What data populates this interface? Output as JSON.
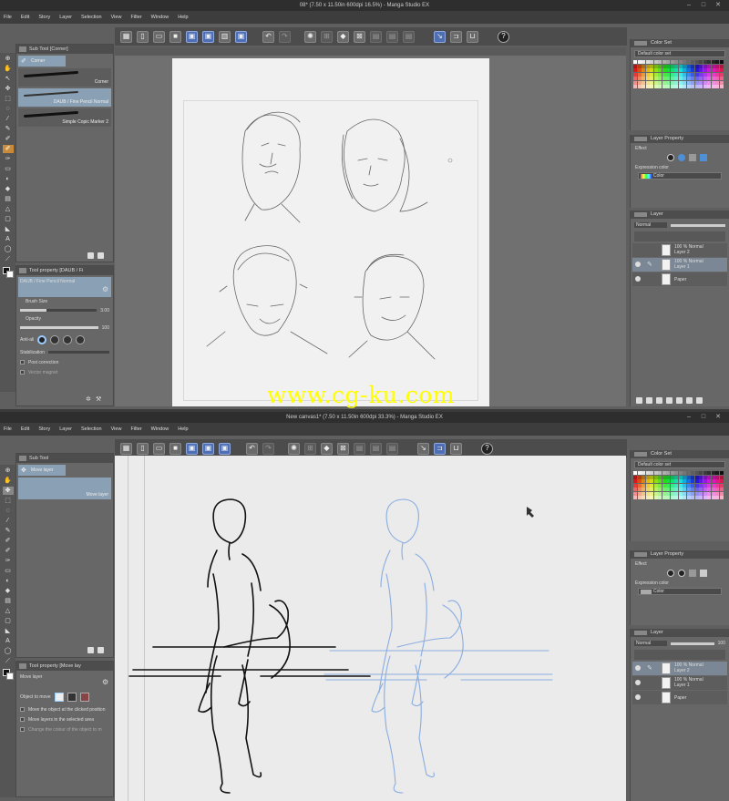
{
  "top_window": {
    "title": "08* (7.50 x 11.50in 600dpi 16.5%) - Manga Studio EX",
    "menu": [
      "File",
      "Edit",
      "Story",
      "Layer",
      "Selection",
      "View",
      "Filter",
      "Window",
      "Help"
    ],
    "sub_tool_tab": "Sub Tool [Corner]",
    "active_group": "Corner",
    "brushes": [
      "Corner",
      "DAUB / Fine Pencil Normal",
      "Simple Copic Marker 2"
    ],
    "tool_property_tab": "Tool property [DAUB / Fi",
    "tool_property_selected": "DAUB / Fine Pencil Normal",
    "brush_size_label": "Brush Size",
    "brush_size_value": "3.00",
    "opacity_label": "Opacity",
    "opacity_value": "100",
    "opacity_fraction": 1.0,
    "brush_size_fraction": 0.35,
    "anti_alias_label": "Anti-ali",
    "stabilization_label": "Stabilization",
    "post_correction_label": "Post correction",
    "vector_magnet_label": "Vector magnet",
    "color_set_tab": "Color Set",
    "color_set_name": "Default color set",
    "layer_property_tab": "Layer Property",
    "effect_label": "Effect",
    "expression_color_label": "Expression color",
    "expression_color_value": "Color",
    "layer_tab": "Layer",
    "blend_mode": "Normal",
    "layers": [
      {
        "pct": "100 %  Normal",
        "name": "Layer 2"
      },
      {
        "pct": "100 %  Normal",
        "name": "Layer 1"
      },
      {
        "pct": "",
        "name": "Paper"
      }
    ]
  },
  "bottom_window": {
    "title": "New canvas1* (7.50 x 11.50in 600dpi 33.3%) - Manga Studio EX",
    "menu": [
      "File",
      "Edit",
      "Story",
      "Layer",
      "Selection",
      "View",
      "Filter",
      "Window",
      "Help"
    ],
    "sub_tool_tab": "Sub Tool",
    "active_group": "Move layer",
    "brushes": [
      "Move layer"
    ],
    "tool_property_tab": "Tool property [Move lay",
    "tool_property_selected": "Move layer",
    "object_to_move_label": "Object to move",
    "option_1": "Move the object at the clicked position",
    "option_2": "Move layers in the selected area",
    "option_3": "Change the colour of the object to m",
    "color_set_tab": "Color Set",
    "color_set_name": "Default color set",
    "layer_property_tab": "Layer Property",
    "effect_label": "Effect",
    "expression_color_label": "Expression color",
    "expression_color_value": "Color",
    "layer_tab": "Layer",
    "blend_mode": "Normal",
    "layer_opacity": "100",
    "layers": [
      {
        "pct": "100 %  Normal",
        "name": "Layer 2"
      },
      {
        "pct": "100 %  Normal",
        "name": "Layer 1"
      },
      {
        "pct": "",
        "name": "Paper"
      }
    ]
  },
  "watermark": "www.cg-ku.com",
  "colors": {
    "accent": "#4e6fb3",
    "active_tool": "#c98b3a",
    "watermark": "#ffff00",
    "blue_sketch": "#7fa6e0"
  }
}
